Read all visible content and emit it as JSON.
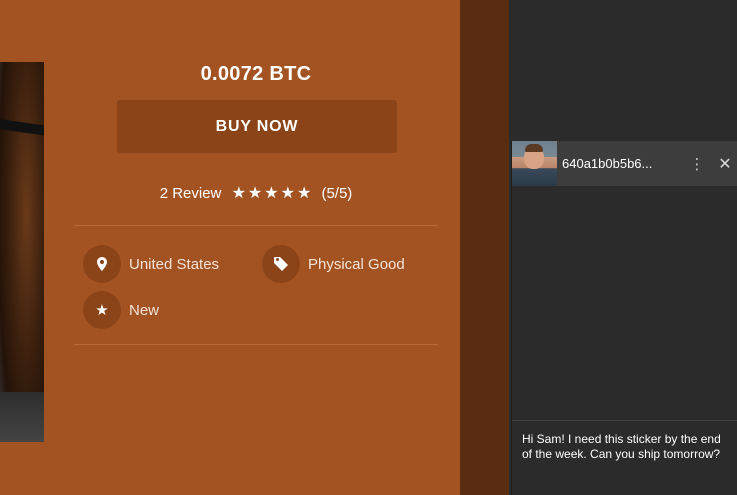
{
  "product": {
    "price": "0.0072 BTC",
    "buy_label": "BUY NOW",
    "review_count": "2 Review",
    "stars": "★★★★★",
    "rating": "(5/5)",
    "rating_value": 5,
    "rating_max": 5,
    "attributes": {
      "location": "United States",
      "type": "Physical Good",
      "condition": "New"
    }
  },
  "chat": {
    "name": "640a1b0b5b6...",
    "menu_icon": "⋮",
    "close_icon": "✕",
    "message_draft": "Hi Sam! I need this sticker by the end of the week. Can you ship tomorrow?"
  },
  "colors": {
    "product_bg": "#a35322",
    "button_bg": "#8a4418",
    "chat_bg": "#2b2b2b",
    "chat_header": "#3d3d3d"
  }
}
